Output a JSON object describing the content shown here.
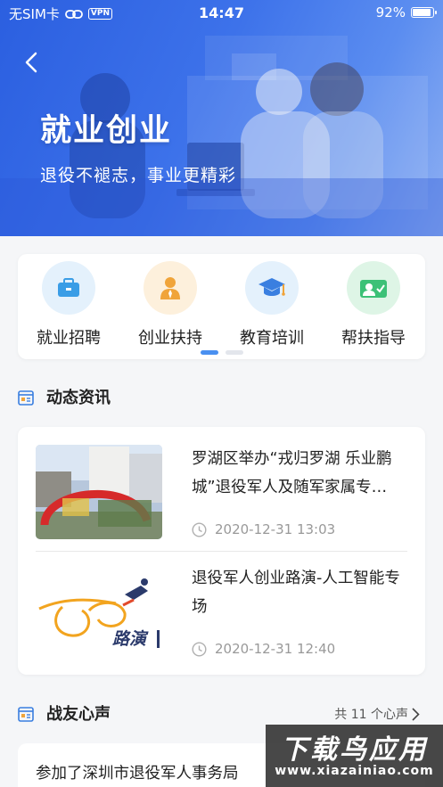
{
  "status_bar": {
    "carrier": "无SIM卡",
    "vpn": "VPN",
    "time": "14:47",
    "battery": "92%",
    "battery_level": 0.92
  },
  "hero": {
    "title": "就业创业",
    "subtitle": "退役不褪志，事业更精彩"
  },
  "services": [
    {
      "label": "就业招聘",
      "icon": "briefcase-icon",
      "bg": "#e4f1fc",
      "color": "#3a9de6"
    },
    {
      "label": "创业扶持",
      "icon": "person-icon",
      "bg": "#fdf0dc",
      "color": "#f0a43a"
    },
    {
      "label": "教育培训",
      "icon": "graduation-cap-icon",
      "bg": "#e4f1fc",
      "color": "#3a7fe0"
    },
    {
      "label": "帮扶指导",
      "icon": "user-card-icon",
      "bg": "#def5e6",
      "color": "#3cc177"
    }
  ],
  "news_section": {
    "title": "动态资讯",
    "items": [
      {
        "title": "罗湖区举办“戎归罗湖 乐业鹏城”退役军人及随军家属专…",
        "time": "2020-12-31 13:03"
      },
      {
        "title": "退役军人创业路演-人工智能专场",
        "time": "2020-12-31 12:40",
        "thumb_text": "路演"
      }
    ]
  },
  "voice_section": {
    "title": "战友心声",
    "more": "共 11 个心声",
    "first_item": "参加了深圳市退役军人事务局"
  },
  "watermark": {
    "main": "下载鸟应用",
    "sub": "www.xiazainiao.com"
  },
  "colors": {
    "accent": "#4a90f0",
    "hero_start": "#2b5fe0"
  }
}
